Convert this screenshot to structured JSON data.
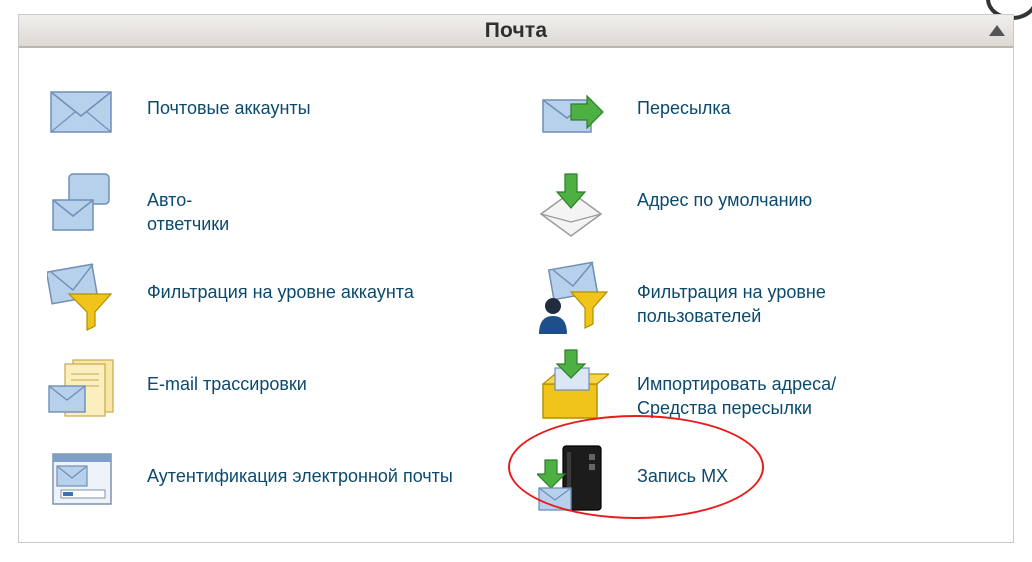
{
  "panel": {
    "title": "Почта"
  },
  "items": [
    {
      "label": "Почтовые аккаунты",
      "icon": "envelope-icon"
    },
    {
      "label": "Пересылка",
      "icon": "forward-envelope-icon"
    },
    {
      "label": "Авто-\nответчики",
      "icon": "autoresponder-icon"
    },
    {
      "label": "Адрес по умолчанию",
      "icon": "default-address-icon"
    },
    {
      "label": "Фильтрация на уровне аккаунта",
      "icon": "account-filter-icon"
    },
    {
      "label": "Фильтрация на уровне\nпользователей",
      "icon": "user-filter-icon"
    },
    {
      "label": "E-mail трассировки",
      "icon": "email-trace-icon"
    },
    {
      "label": "Импортировать адреса/\nСредства пересылки",
      "icon": "import-icon"
    },
    {
      "label": "Аутентификация электронной почты",
      "icon": "email-auth-icon"
    },
    {
      "label": "Запись MX",
      "icon": "mx-record-icon"
    }
  ],
  "colors": {
    "link": "#0b4a6e",
    "highlight": "#e81c1c",
    "envelope": "#a9c6e6",
    "arrow_green": "#3fa535",
    "funnel": "#e6b800"
  }
}
